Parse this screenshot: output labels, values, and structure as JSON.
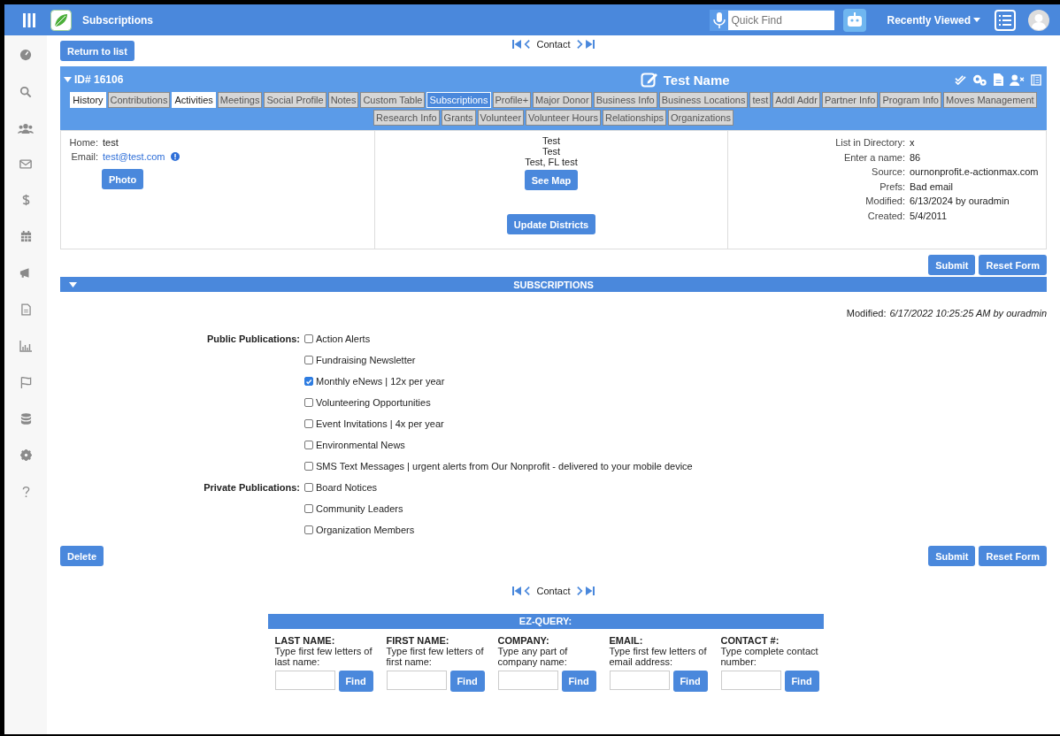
{
  "app_bar": {
    "title": "Subscriptions",
    "search": {
      "placeholder": "Quick Find"
    },
    "recently_viewed": "Recently Viewed"
  },
  "top_nav": {
    "return_button": "Return to list",
    "record_label": "Contact"
  },
  "record": {
    "id": "ID# 16106",
    "name": "Test Name",
    "tab_rows": [
      [
        {
          "label": "History",
          "selected": false,
          "filled": true
        },
        {
          "label": "Contributions",
          "selected": false,
          "filled": false
        },
        {
          "label": "Activities",
          "selected": false,
          "filled": true
        },
        {
          "label": "Meetings",
          "selected": false,
          "filled": false
        },
        {
          "label": "Social Profile",
          "selected": false,
          "filled": false
        },
        {
          "label": "Notes",
          "selected": false,
          "filled": false
        },
        {
          "label": "Custom Table",
          "selected": false,
          "filled": false
        },
        {
          "label": "Subscriptions",
          "selected": true
        },
        {
          "label": "Profile+",
          "selected": false,
          "filled": false
        },
        {
          "label": "Major Donor",
          "selected": false,
          "filled": false
        },
        {
          "label": "Business Info",
          "selected": false,
          "filled": false
        },
        {
          "label": "Business Locations",
          "selected": false,
          "filled": false
        },
        {
          "label": "test",
          "selected": false,
          "filled": false
        },
        {
          "label": "Addl Addr",
          "selected": false,
          "filled": false
        },
        {
          "label": "Partner Info",
          "selected": false,
          "filled": false
        },
        {
          "label": "Program Info",
          "selected": false,
          "filled": false
        },
        {
          "label": "Moves Management",
          "selected": false,
          "filled": false
        }
      ],
      [
        {
          "label": "Research Info",
          "selected": false,
          "filled": false
        },
        {
          "label": "Grants",
          "selected": false,
          "filled": false
        },
        {
          "label": "Volunteer",
          "selected": false,
          "filled": false
        },
        {
          "label": "Volunteer Hours",
          "selected": false,
          "filled": false
        },
        {
          "label": "Relationships",
          "selected": false,
          "filled": false
        },
        {
          "label": "Organizations",
          "selected": false,
          "filled": false
        }
      ]
    ]
  },
  "contact": {
    "home": {
      "label": "Home:",
      "value": "test"
    },
    "email": {
      "label": "Email:",
      "value": "test@test.com"
    },
    "photo_button": "Photo",
    "address_lines": [
      "Test",
      "Test",
      "Test, FL test"
    ],
    "see_map_button": "See Map",
    "update_districts_button": "Update Districts",
    "details": [
      {
        "label": "List in Directory:",
        "value": "x"
      },
      {
        "label": "Enter a name:",
        "value": "86"
      },
      {
        "label": "Source:",
        "value": "ournonprofit.e-actionmax.com"
      },
      {
        "label": "Prefs:",
        "value": "Bad email"
      },
      {
        "label": "Modified:",
        "value": "6/13/2024 by ouradmin"
      },
      {
        "label": "Created:",
        "value": "5/4/2011"
      }
    ]
  },
  "top_actions": [
    "Submit",
    "Reset Form"
  ],
  "subscriptions": {
    "title": "SUBSCRIPTIONS",
    "modified_label": "Modified:",
    "modified_value": "6/17/2022 10:25:25 AM by ouradmin",
    "groups": [
      {
        "label": "Public Publications:",
        "items": [
          {
            "label": "Action Alerts",
            "checked": false
          },
          {
            "label": "Fundraising Newsletter",
            "checked": false
          },
          {
            "label": "Monthly eNews | 12x per year",
            "checked": true
          },
          {
            "label": "Volunteering Opportunities",
            "checked": false
          },
          {
            "label": "Event Invitations | 4x per year",
            "checked": false
          },
          {
            "label": "Environmental News",
            "checked": false
          },
          {
            "label": "SMS Text Messages | urgent alerts from Our Nonprofit - delivered to your mobile device",
            "checked": false
          }
        ]
      },
      {
        "label": "Private Publications:",
        "items": [
          {
            "label": "Board Notices",
            "checked": false
          },
          {
            "label": "Community Leaders",
            "checked": false
          },
          {
            "label": "Organization Members",
            "checked": false
          }
        ]
      }
    ]
  },
  "bottom_actions": {
    "delete": "Delete",
    "submit": "Submit",
    "reset": "Reset Form"
  },
  "bottom_nav": {
    "record_label": "Contact"
  },
  "ez_query": {
    "title": "EZ-QUERY:",
    "fields": [
      {
        "label": "LAST NAME:",
        "hint": "Type first few letters of last name:",
        "button": "Find"
      },
      {
        "label": "FIRST NAME:",
        "hint": "Type first few letters of first name:",
        "button": "Find"
      },
      {
        "label": "COMPANY:",
        "hint": "Type any part of company name:",
        "button": "Find"
      },
      {
        "label": "EMAIL:",
        "hint": "Type first few letters of email address:",
        "button": "Find"
      },
      {
        "label": "CONTACT #:",
        "hint": "Type complete contact number:",
        "button": "Find"
      }
    ]
  }
}
